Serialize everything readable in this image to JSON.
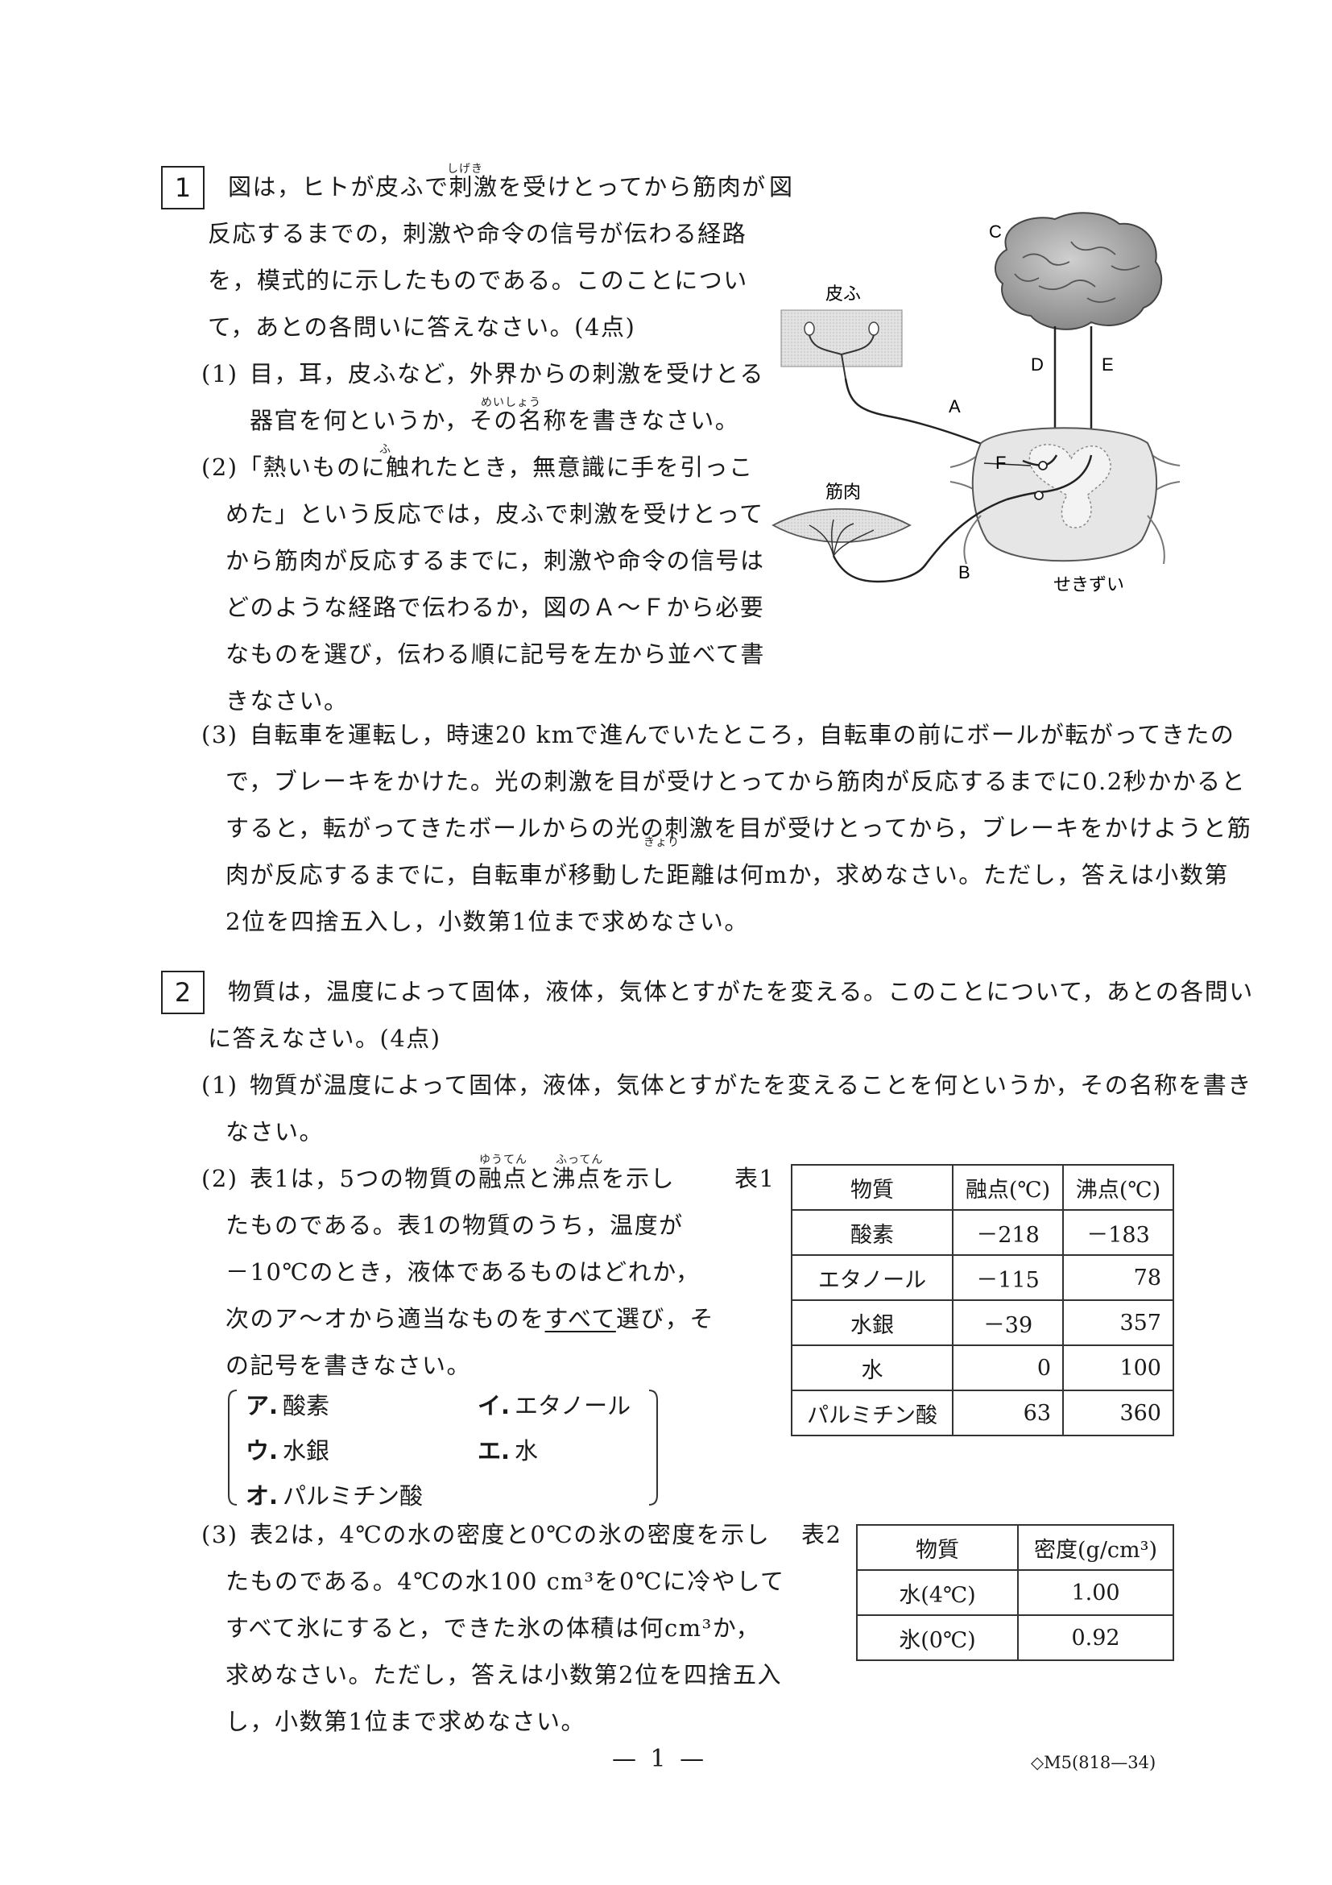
{
  "q1": {
    "number": "1",
    "intro_lines": [
      "図は，ヒトが皮ふで刺激を受けとってから筋肉が",
      "反応するまでの，刺激や命令の信号が伝わる経路",
      "を，模式的に示したものである。このことについ",
      "て，あとの各問いに答えなさい。(4点)"
    ],
    "ruby_shigeki": "しげき",
    "p1_label": "(1)",
    "p1_lines": [
      "目，耳，皮ふなど，外界からの刺激を受けとる",
      "器官を何というか，その名称を書きなさい。"
    ],
    "ruby_meishou": "めいしょう",
    "p2_label": "(2)",
    "p2_lines": [
      "「熱いものに触れたとき，無意識に手を引っこ",
      "めた」という反応では，皮ふで刺激を受けとって",
      "から筋肉が反応するまでに，刺激や命令の信号は",
      "どのような経路で伝わるか，図のＡ～Ｆから必要",
      "なものを選び，伝わる順に記号を左から並べて書",
      "きなさい。"
    ],
    "ruby_fu": "ふ",
    "p3_label": "(3)",
    "p3_lines": [
      "自転車を運転し，時速20 kmで進んでいたところ，自転車の前にボールが転がってきたの",
      "で，ブレーキをかけた。光の刺激を目が受けとってから筋肉が反応するまでに0.2秒かかると",
      "すると，転がってきたボールからの光の刺激を目が受けとってから，ブレーキをかけようと筋",
      "肉が反応するまでに，自転車が移動した距離は何mか，求めなさい。ただし，答えは小数第",
      "2位を四捨五入し，小数第1位まで求めなさい。"
    ],
    "ruby_kyori": "きょり",
    "figure": {
      "caption": "図",
      "skin_label": "皮ふ",
      "muscle_label": "筋肉",
      "spine_label": "せきずい",
      "letters": {
        "a": "A",
        "b": "B",
        "c": "C",
        "d": "D",
        "e": "E",
        "f": "F"
      }
    }
  },
  "q2": {
    "number": "2",
    "intro_lines": [
      "物質は，温度によって固体，液体，気体とすがたを変える。このことについて，あとの各問い",
      "に答えなさい。(4点)"
    ],
    "p1_label": "(1)",
    "p1_lines": [
      "物質が温度によって固体，液体，気体とすがたを変えることを何というか，その名称を書き",
      "なさい。"
    ],
    "p2_label": "(2)",
    "p2_line1_pre": "表1は，5つの物質の",
    "p2_line1_w1": "融点",
    "p2_line1_mid": "と",
    "p2_line1_w2": "沸点",
    "p2_line1_post": "を示し",
    "ruby_yuuten": "ゆうてん",
    "ruby_futten": "ふってん",
    "p2_lines": [
      "たものである。表1の物質のうち，温度が",
      "－10℃のとき，液体であるものはどれか，"
    ],
    "p2_line4_pre": "次のア～オから適当なものを",
    "p2_line4_ul": "すべて",
    "p2_line4_post": "選び，そ",
    "p2_line5": "の記号を書きなさい。",
    "options": [
      {
        "key": "ア.",
        "text": "酸素"
      },
      {
        "key": "イ.",
        "text": "エタノール"
      },
      {
        "key": "ウ.",
        "text": "水銀"
      },
      {
        "key": "エ.",
        "text": "水"
      },
      {
        "key": "オ.",
        "text": "パルミチン酸"
      }
    ],
    "table1": {
      "caption": "表1",
      "headers": [
        "物質",
        "融点(℃)",
        "沸点(℃)"
      ],
      "rows": [
        [
          "酸素",
          "－218",
          "－183"
        ],
        [
          "エタノール",
          "－115",
          "78"
        ],
        [
          "水銀",
          "－39",
          "357"
        ],
        [
          "水",
          "0",
          "100"
        ],
        [
          "パルミチン酸",
          "63",
          "360"
        ]
      ]
    },
    "p3_label": "(3)",
    "p3_lines": [
      "表2は，4℃の水の密度と0℃の氷の密度を示し",
      "たものである。4℃の水100 cm³を0℃に冷やして",
      "すべて氷にすると，できた氷の体積は何cm³か，",
      "求めなさい。ただし，答えは小数第2位を四捨五入",
      "し，小数第1位まで求めなさい。"
    ],
    "table2": {
      "caption": "表2",
      "headers": [
        "物質",
        "密度(g/cm³)"
      ],
      "rows": [
        [
          "水(4℃)",
          "1.00"
        ],
        [
          "氷(0℃)",
          "0.92"
        ]
      ]
    }
  },
  "footer": {
    "page": "— 1 —",
    "code": "◇M5(818—34)"
  }
}
